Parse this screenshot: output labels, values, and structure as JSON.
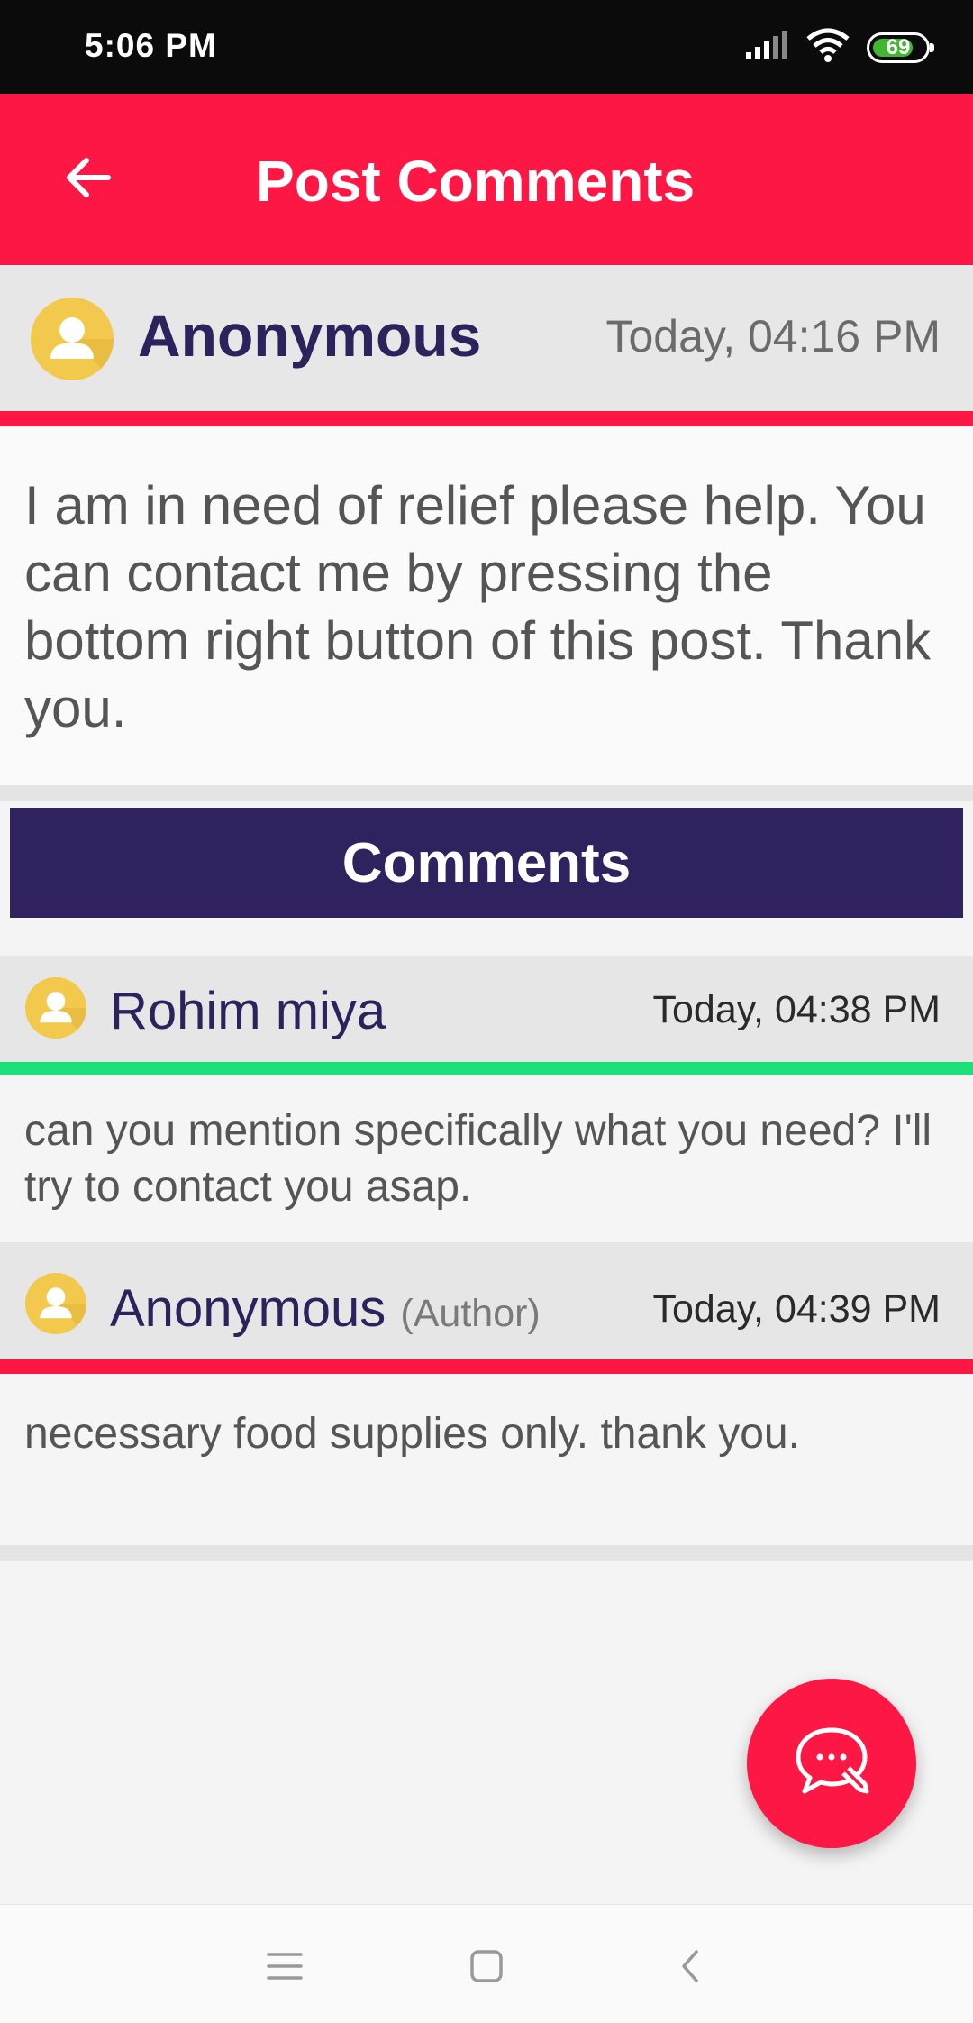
{
  "status_bar": {
    "time": "5:06 PM",
    "battery": "69"
  },
  "app_bar": {
    "title": "Post Comments",
    "back_icon": "arrow-back-icon"
  },
  "post": {
    "author": "Anonymous",
    "time": "Today, 04:16 PM",
    "text": "I am in need of relief please help. You can contact me by pressing the bottom right button of this post. Thank you.",
    "accent": "#fc1745"
  },
  "comments_section": {
    "title": "Comments"
  },
  "comments": [
    {
      "name": "Rohim miya",
      "tag": "",
      "time": "Today, 04:38 PM",
      "text": "can you mention specifically what you need? I'll try to contact you asap.",
      "accent": "#1ee07a"
    },
    {
      "name": "Anonymous",
      "tag": "(Author)",
      "time": "Today, 04:39 PM",
      "text": "necessary food supplies only. thank you.",
      "accent": "#fc1745"
    }
  ],
  "fab": {
    "icon": "comment-edit-icon"
  },
  "nav_bar": {
    "icons": [
      "menu-icon",
      "home-square-icon",
      "back-chevron-icon"
    ]
  },
  "colors": {
    "primary": "#fc1745",
    "navy": "#2f225e",
    "avatar": "#f2c94c",
    "green": "#1ee07a"
  }
}
